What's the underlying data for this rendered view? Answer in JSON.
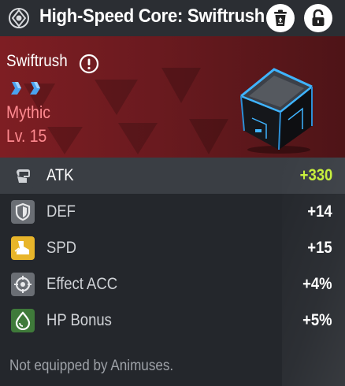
{
  "header": {
    "title": "High-Speed Core: Swiftrush",
    "type_icon": "core-type-icon",
    "recycle_icon": "recycle-bin-icon",
    "lock_icon": "unlock-icon"
  },
  "item": {
    "name": "Swiftrush",
    "info_icon": "exclamation-icon",
    "star_count": 2,
    "rarity": "Mythic",
    "level": "Lv. 15",
    "image": "core-cube-image"
  },
  "stats": [
    {
      "label": "ATK",
      "value": "+330",
      "icon": "fist-icon",
      "icon_color": "#3b3f45"
    },
    {
      "label": "DEF",
      "value": "+14",
      "icon": "shield-icon",
      "icon_color": "#6a6e74"
    },
    {
      "label": "SPD",
      "value": "+15",
      "icon": "boot-icon",
      "icon_color": "#e8b52a"
    },
    {
      "label": "Effect ACC",
      "value": "+4%",
      "icon": "target-icon",
      "icon_color": "#6a6e74"
    },
    {
      "label": "HP Bonus",
      "value": "+5%",
      "icon": "droplet-icon",
      "icon_color": "#3f7a3a"
    }
  ],
  "footer": {
    "text": "Not equipped by Animuses."
  },
  "colors": {
    "hero_red": "#7e1e23",
    "rarity_text": "#ff8a90",
    "atk_value": "#c6ef3a",
    "star_blue": "#4aa3f0"
  }
}
